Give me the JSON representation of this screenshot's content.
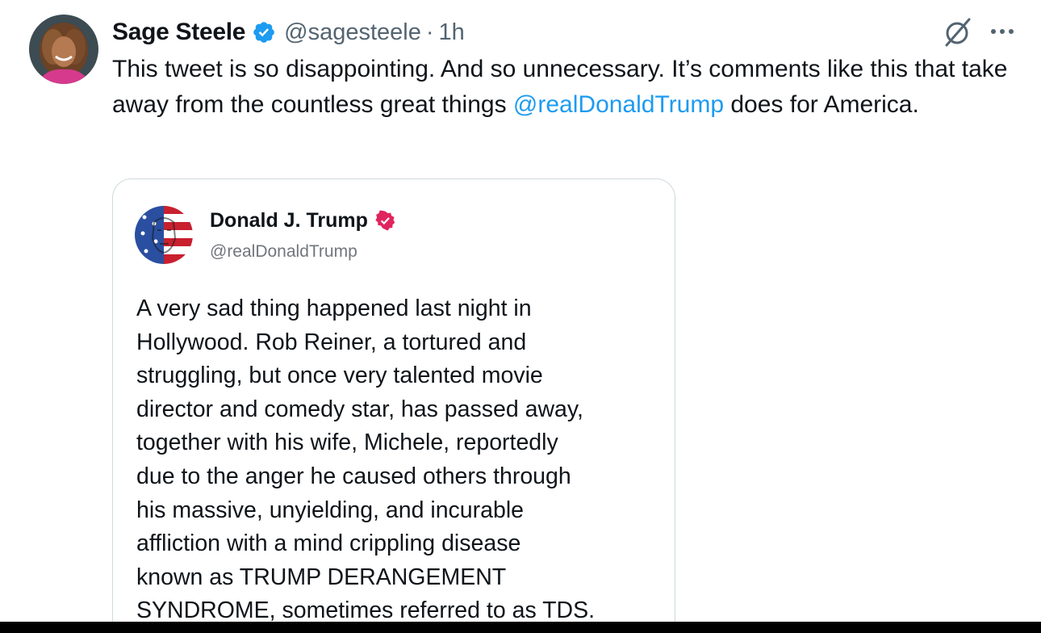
{
  "tweet": {
    "author": {
      "display_name": "Sage Steele",
      "handle": "@sagesteele",
      "verified_icon": "blue-verified-badge",
      "accent_color": "#1d9bf0"
    },
    "separator": "·",
    "timestamp": "1h",
    "actions": {
      "grok_icon": "grok-icon",
      "more_icon": "more-dots-icon"
    },
    "text": {
      "before_mention": "This tweet is so disappointing.  And so unnecessary.  It’s comments like this that take away from the countless great things ",
      "mention": "@realDonaldTrump",
      "after_mention": " does for America."
    }
  },
  "quoted": {
    "author": {
      "display_name": "Donald J. Trump",
      "handle": "@realDonaldTrump",
      "verified_icon": "red-verified-badge",
      "badge_color": "#e0245e"
    },
    "text": "A very sad thing happened last night in\nHollywood. Rob Reiner, a tortured and\nstruggling, but once very talented movie\ndirector and comedy star, has passed away,\ntogether with his wife, Michele, reportedly\ndue to the anger he caused others through\nhis massive, unyielding, and incurable\naffliction with a mind crippling disease\nknown as TRUMP DERANGEMENT\nSYNDROME, sometimes referred to as TDS."
  }
}
